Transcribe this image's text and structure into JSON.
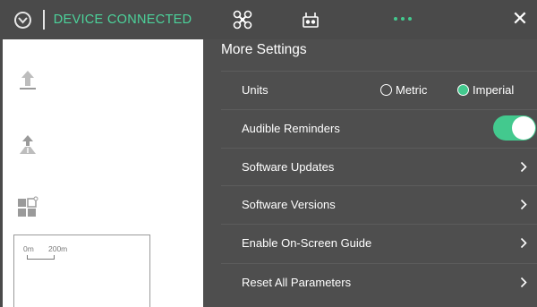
{
  "status": {
    "text": "DEVICE CONNECTED",
    "accent": "#4cd39b"
  },
  "sidebar": {
    "icons": [
      "takeoff-icon",
      "return-home-icon",
      "widgets-icon"
    ]
  },
  "map": {
    "scale_start": "0m",
    "scale_end": "200m"
  },
  "header": {
    "tabs": [
      "aircraft-icon",
      "remote-controller-icon",
      "more-icon"
    ],
    "close_icon": "close-icon"
  },
  "settings": {
    "title": "More Settings",
    "units": {
      "label": "Units",
      "options": [
        "Metric",
        "Imperial"
      ],
      "selected": "Imperial"
    },
    "audible": {
      "label": "Audible Reminders",
      "enabled": true
    },
    "items": [
      "Software Updates",
      "Software Versions",
      "Enable On-Screen Guide",
      "Reset All Parameters"
    ]
  },
  "colors": {
    "panel": "#4e4e4e",
    "accent": "#43c98e"
  }
}
